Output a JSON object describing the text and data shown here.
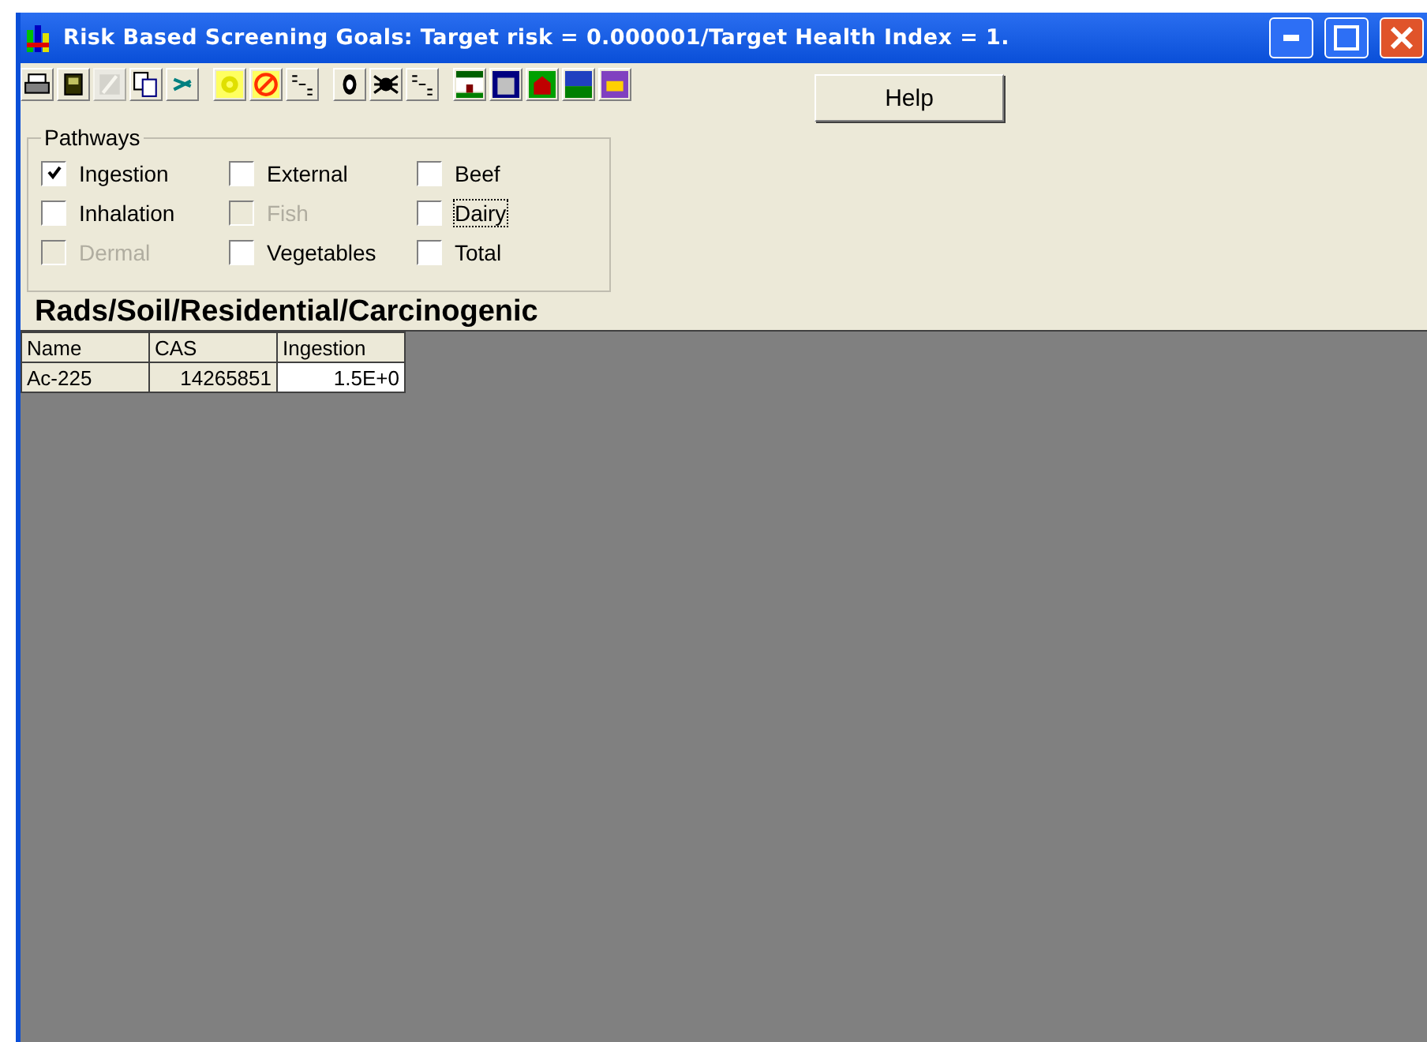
{
  "window": {
    "title": "Risk Based Screening Goals: Target risk = 0.000001/Target Health Index = 1."
  },
  "toolbar": [
    [
      {
        "kind": "printer",
        "disabled": false
      },
      {
        "kind": "disk",
        "disabled": false
      },
      {
        "kind": "pencil",
        "disabled": true
      },
      {
        "kind": "copy",
        "disabled": false
      },
      {
        "kind": "arrows",
        "disabled": false
      }
    ],
    [
      {
        "kind": "radiation",
        "disabled": false
      },
      {
        "kind": "prohibited",
        "disabled": false
      },
      {
        "kind": "letters",
        "disabled": false
      }
    ],
    [
      {
        "kind": "bug",
        "disabled": false
      },
      {
        "kind": "spider",
        "disabled": false
      },
      {
        "kind": "letters",
        "disabled": false
      }
    ],
    [
      {
        "kind": "house",
        "disabled": false
      },
      {
        "kind": "building",
        "disabled": false
      },
      {
        "kind": "barn",
        "disabled": false
      },
      {
        "kind": "field",
        "disabled": false
      },
      {
        "kind": "bulldozer",
        "disabled": false
      }
    ]
  ],
  "help_button": "Help",
  "pathways": {
    "label": "Pathways",
    "items": [
      {
        "label": "Ingestion",
        "checked": true,
        "disabled": false,
        "focused": false
      },
      {
        "label": "Inhalation",
        "checked": false,
        "disabled": false,
        "focused": false
      },
      {
        "label": "Dermal",
        "checked": false,
        "disabled": true,
        "focused": false
      },
      {
        "label": "External",
        "checked": false,
        "disabled": false,
        "focused": false
      },
      {
        "label": "Fish",
        "checked": false,
        "disabled": true,
        "focused": false
      },
      {
        "label": "Vegetables",
        "checked": false,
        "disabled": false,
        "focused": false
      },
      {
        "label": "Beef",
        "checked": false,
        "disabled": false,
        "focused": false
      },
      {
        "label": "Dairy",
        "checked": false,
        "disabled": false,
        "focused": true
      },
      {
        "label": "Total",
        "checked": false,
        "disabled": false,
        "focused": false
      }
    ]
  },
  "heading": "Rads/Soil/Residential/Carcinogenic",
  "table": {
    "columns": [
      "Name",
      "CAS",
      "Ingestion"
    ],
    "rows": [
      [
        {
          "text": "Ac-225",
          "selected": false
        },
        {
          "text": "14265851",
          "selected": false
        },
        {
          "text": "1.5E+0",
          "selected": true
        }
      ]
    ]
  }
}
